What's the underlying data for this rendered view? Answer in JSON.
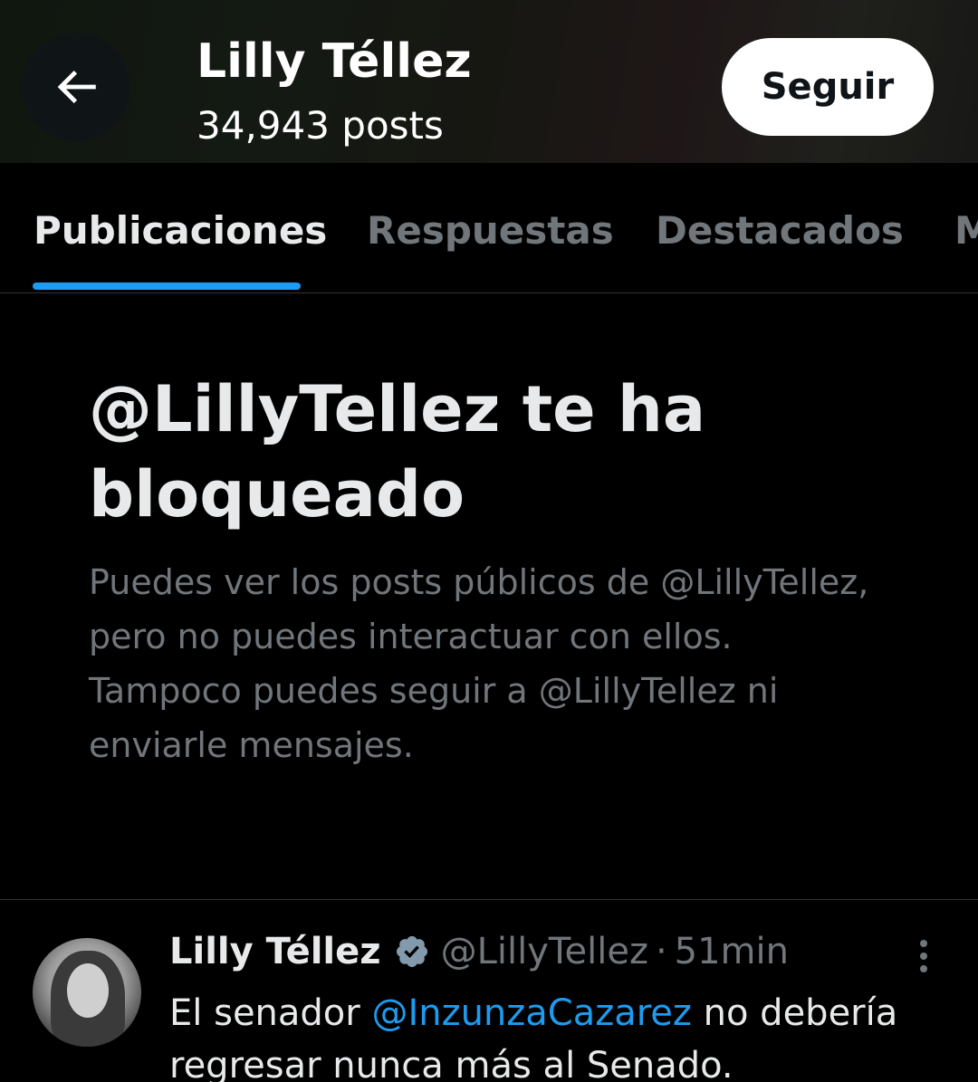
{
  "header": {
    "title": "Lilly Téllez",
    "post_count": "34,943 posts",
    "follow_label": "Seguir"
  },
  "tabs": [
    {
      "label": "Publicaciones",
      "active": true
    },
    {
      "label": "Respuestas",
      "active": false
    },
    {
      "label": "Destacados",
      "active": false
    },
    {
      "label": "M",
      "active": false
    }
  ],
  "blocked": {
    "title": "@LillyTellez te ha bloqueado",
    "description": "Puedes ver los posts públicos de @LillyTellez, pero no puedes interactuar con ellos. Tampoco puedes seguir a @LillyTellez ni enviarle mensajes."
  },
  "post": {
    "author_name": "Lilly Téllez",
    "handle": "@LillyTellez",
    "separator": "·",
    "time": "51min",
    "text_before": "El senador ",
    "mention": "@InzunzaCazarez",
    "text_after": " no debería regresar nunca más al Senado."
  },
  "colors": {
    "accent": "#1d9bf0",
    "text_primary": "#e7e9ea",
    "text_secondary": "#71767b",
    "background": "#000000",
    "verified": "#829aab"
  },
  "icons": {
    "back": "arrow-left-icon",
    "verified": "verified-badge-icon",
    "more": "more-vertical-icon"
  }
}
